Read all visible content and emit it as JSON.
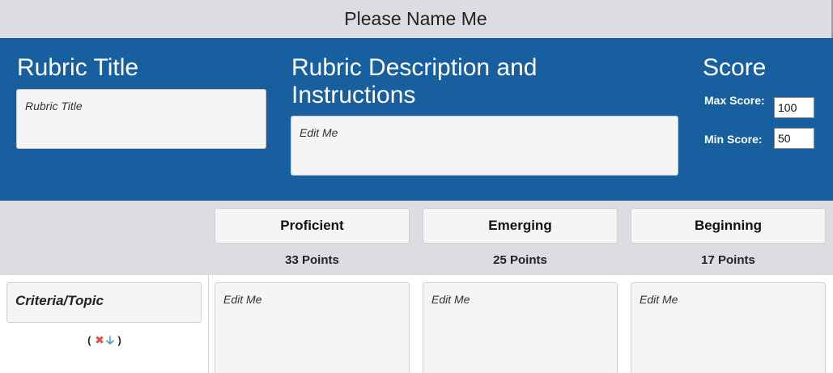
{
  "app": {
    "name": "Please Name Me"
  },
  "header": {
    "rubric_title_heading": "Rubric Title",
    "rubric_title_value": "Rubric Title",
    "description_heading": "Rubric Description and Instructions",
    "description_value": "Edit Me",
    "score_heading": "Score",
    "max_score_label": "Max Score:",
    "max_score_value": "100",
    "min_score_label": "Min Score:",
    "min_score_value": "50"
  },
  "levels": [
    {
      "label": "Proficient",
      "points": "33 Points"
    },
    {
      "label": "Emerging",
      "points": "25 Points"
    },
    {
      "label": "Beginning",
      "points": "17 Points"
    }
  ],
  "criteria": {
    "label": "Criteria/Topic",
    "actions_open": "(",
    "actions_close": ")",
    "remove_icon": "x-icon",
    "move_down_icon": "arrow-down-icon",
    "cells": [
      "Edit Me",
      "Edit Me",
      "Edit Me"
    ]
  },
  "colors": {
    "header_blue": "#175f9e",
    "bar_gray": "#dcdde0",
    "remove_red": "#d9534f",
    "move_blue": "#3a8fd6"
  }
}
